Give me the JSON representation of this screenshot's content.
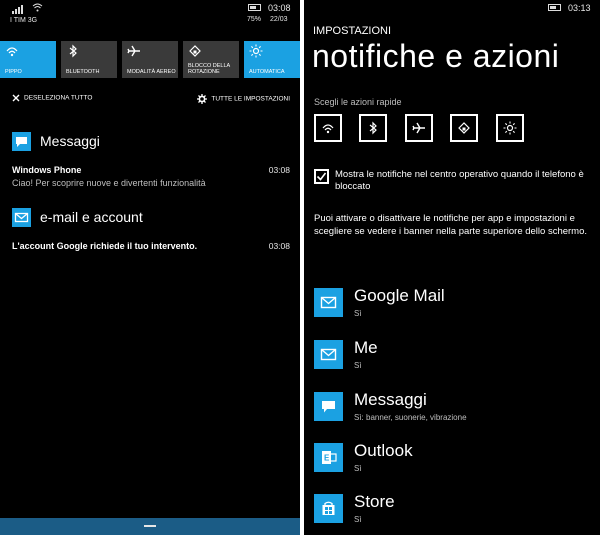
{
  "left": {
    "status": {
      "carrier": "I TIM 3G",
      "time": "03:08",
      "battery": "75%",
      "date": "22/03"
    },
    "tiles": [
      {
        "label": "PIPPO",
        "icon": "wifi-icon",
        "active": true
      },
      {
        "label": "BLUETOOTH",
        "icon": "bluetooth-icon",
        "active": false
      },
      {
        "label": "MODALITÀ AEREO",
        "icon": "airplane-icon",
        "active": false
      },
      {
        "label": "BLOCCO DELLA ROTAZIONE",
        "icon": "rotation-lock-icon",
        "active": false
      },
      {
        "label": "AUTOMATICA",
        "icon": "brightness-icon",
        "active": true
      }
    ],
    "deselect_label": "DESELEZIONA TUTTO",
    "all_settings_label": "TUTTE LE IMPOSTAZIONI",
    "groups": [
      {
        "title": "Messaggi",
        "icon": "message-icon",
        "notification": {
          "title": "Windows Phone",
          "body": "Ciao! Per scoprire nuove e divertenti funzionalità",
          "time": "03:08"
        }
      },
      {
        "title": "e-mail e account",
        "icon": "mail-icon",
        "notification": {
          "title": "L'account Google richiede il tuo intervento.",
          "body": "",
          "time": "03:08"
        }
      }
    ]
  },
  "right": {
    "status": {
      "time": "03:13"
    },
    "section": "IMPOSTAZIONI",
    "title": "notifiche e azioni",
    "quick_actions_label": "Scegli le azioni rapide",
    "quick_actions": [
      "wifi-icon",
      "bluetooth-icon",
      "airplane-icon",
      "rotation-lock-icon",
      "brightness-icon"
    ],
    "checkbox": {
      "checked": true,
      "label": "Mostra le notifiche nel centro operativo quando il telefono è bloccato"
    },
    "info": "Puoi attivare o disattivare le notifiche per app e impostazioni e scegliere se vedere i banner nella parte superiore dello schermo.",
    "apps": [
      {
        "name": "Google Mail",
        "status": "Sì",
        "icon": "mail-icon"
      },
      {
        "name": "Me",
        "status": "Sì",
        "icon": "mail-icon"
      },
      {
        "name": "Messaggi",
        "status": "Sì: banner, suonerie, vibrazione",
        "icon": "message-icon"
      },
      {
        "name": "Outlook",
        "status": "Sì",
        "icon": "outlook-icon"
      },
      {
        "name": "Store",
        "status": "Sì",
        "icon": "store-icon"
      }
    ]
  },
  "colors": {
    "accent": "#1ba1e2",
    "bottom_bar": "#1b5c86",
    "tile_off": "#3a3a3a",
    "background": "#000000"
  }
}
